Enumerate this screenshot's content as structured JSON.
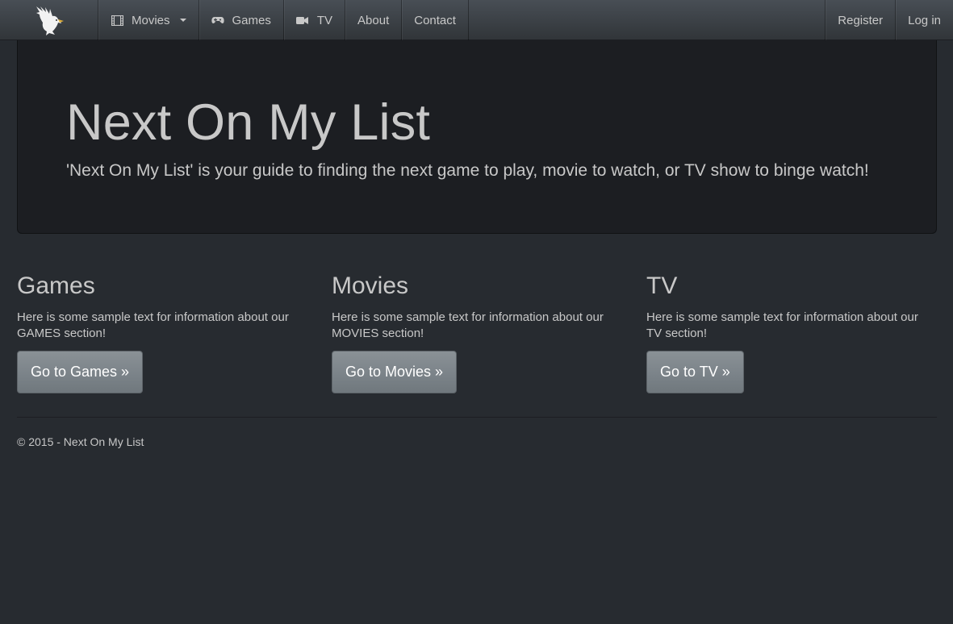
{
  "navbar": {
    "brand_icon": "eagle-logo",
    "items": [
      {
        "label": "Movies",
        "icon": "film-icon",
        "dropdown": true
      },
      {
        "label": "Games",
        "icon": "gamepad-icon"
      },
      {
        "label": "TV",
        "icon": "video-camera-icon"
      },
      {
        "label": "About"
      },
      {
        "label": "Contact"
      }
    ],
    "right": [
      {
        "label": "Register"
      },
      {
        "label": "Log in"
      }
    ]
  },
  "jumbotron": {
    "title": "Next On My List",
    "lead": "'Next On My List' is your guide to finding the next game to play, movie to watch, or TV show to binge watch!"
  },
  "sections": [
    {
      "heading": "Games",
      "text": "Here is some sample text for information about our GAMES section!",
      "button": "Go to Games »"
    },
    {
      "heading": "Movies",
      "text": "Here is some sample text for information about our MOVIES section!",
      "button": "Go to Movies »"
    },
    {
      "heading": "TV",
      "text": "Here is some sample text for information about our TV section!",
      "button": "Go to TV »"
    }
  ],
  "footer": {
    "text": "© 2015 - Next On My List"
  },
  "colors": {
    "background": "#272b30",
    "navbar": "#3a3f44",
    "jumbotron": "#1c1e22",
    "button": "#7a8288",
    "text": "#c8c8c8"
  }
}
